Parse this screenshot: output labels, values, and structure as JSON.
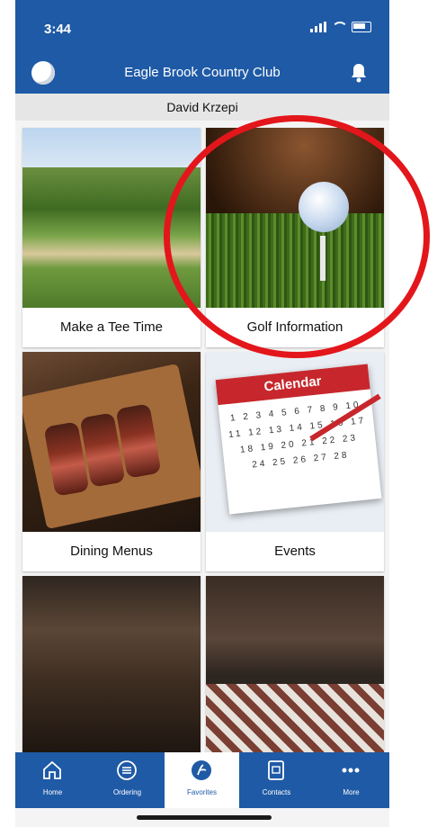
{
  "status": {
    "time": "3:44"
  },
  "header": {
    "title": "Eagle Brook Country Club"
  },
  "user": {
    "name": "David Krzepi"
  },
  "tiles": [
    {
      "label": "Make a Tee Time"
    },
    {
      "label": "Golf Information"
    },
    {
      "label": "Dining Menus"
    },
    {
      "label": "Events"
    },
    {
      "label": ""
    },
    {
      "label": ""
    }
  ],
  "calendar": {
    "title": "Calendar",
    "numbers": "1 2 3 4 5 6 7 8 9 10 11 12 13 14 15 16 17 18 19 20 21 22 23 24 25 26 27 28"
  },
  "tabs": [
    {
      "label": "Home",
      "icon": "home-icon"
    },
    {
      "label": "Ordering",
      "icon": "ordering-icon"
    },
    {
      "label": "Favorites",
      "icon": "club-logo-icon"
    },
    {
      "label": "Contacts",
      "icon": "contacts-icon"
    },
    {
      "label": "More",
      "icon": "more-icon"
    }
  ],
  "colors": {
    "brand_blue": "#1f5aa6",
    "highlight_red": "#e3161b"
  }
}
